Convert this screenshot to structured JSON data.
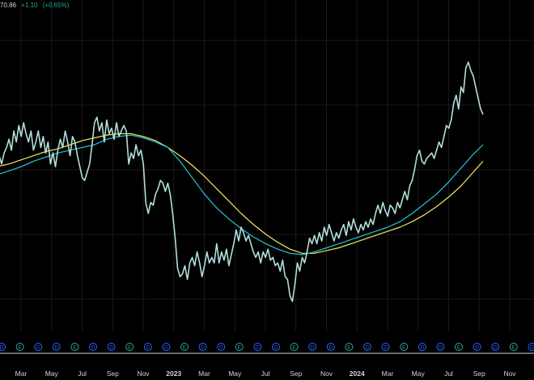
{
  "header": {
    "price": "70.86",
    "change": "+1.10",
    "change_pct": "(+0.65%)"
  },
  "colors": {
    "background": "#000000",
    "grid": "#1a1a1a",
    "price_line": "#b2dfdb",
    "ma_fast": "#26c6da",
    "ma_slow": "#f5e663",
    "dividend": "#2962ff",
    "earnings_green": "#26a69a",
    "earnings_red": "#ef5350",
    "axis_text": "#d1d4dc"
  },
  "chart_data": {
    "type": "line",
    "x_labels": [
      "Mar",
      "May",
      "Jul",
      "Sep",
      "Nov",
      "2023",
      "Mar",
      "May",
      "Jul",
      "Sep",
      "Nov",
      "2024",
      "Mar",
      "May",
      "Jul",
      "Sep",
      "Nov"
    ],
    "x_label_bold": [
      false,
      false,
      false,
      false,
      false,
      true,
      false,
      false,
      false,
      false,
      false,
      true,
      false,
      false,
      false,
      false,
      false
    ],
    "y_visible_range": [
      0,
      100
    ],
    "series": [
      {
        "role": "price",
        "values": [
          [
            0,
            60
          ],
          [
            0.2,
            61
          ],
          [
            0.4,
            58
          ],
          [
            0.6,
            62
          ],
          [
            0.8,
            64
          ],
          [
            1.0,
            67
          ],
          [
            1.2,
            63
          ],
          [
            1.4,
            70
          ],
          [
            1.6,
            66
          ],
          [
            1.8,
            72
          ],
          [
            2.0,
            68
          ],
          [
            2.2,
            73
          ],
          [
            2.4,
            69
          ],
          [
            2.6,
            66
          ],
          [
            2.8,
            70
          ],
          [
            3.0,
            63
          ],
          [
            3.2,
            66
          ],
          [
            3.4,
            70
          ],
          [
            3.6,
            64
          ],
          [
            3.8,
            68
          ],
          [
            4.0,
            62
          ],
          [
            4.2,
            66
          ],
          [
            4.4,
            58
          ],
          [
            4.6,
            62
          ],
          [
            4.8,
            57
          ],
          [
            5.0,
            63
          ],
          [
            5.2,
            67
          ],
          [
            5.4,
            64
          ],
          [
            5.6,
            70
          ],
          [
            5.8,
            66
          ],
          [
            6.0,
            61
          ],
          [
            6.2,
            68
          ],
          [
            6.4,
            66
          ],
          [
            6.6,
            61
          ],
          [
            6.8,
            57
          ],
          [
            7.0,
            53
          ],
          [
            7.2,
            52
          ],
          [
            7.4,
            55
          ],
          [
            7.6,
            58
          ],
          [
            7.8,
            65
          ],
          [
            8.0,
            73
          ],
          [
            8.2,
            75
          ],
          [
            8.4,
            70
          ],
          [
            8.6,
            73
          ],
          [
            8.8,
            66
          ],
          [
            9.0,
            74
          ],
          [
            9.2,
            69
          ],
          [
            9.4,
            71
          ],
          [
            9.6,
            67
          ],
          [
            9.8,
            73
          ],
          [
            10.0,
            68
          ],
          [
            10.2,
            70
          ],
          [
            10.4,
            72
          ],
          [
            10.6,
            70
          ],
          [
            10.8,
            58
          ],
          [
            11.0,
            62
          ],
          [
            11.2,
            60
          ],
          [
            11.4,
            65
          ],
          [
            11.6,
            61
          ],
          [
            11.8,
            63
          ],
          [
            12.0,
            58
          ],
          [
            12.2,
            44
          ],
          [
            12.4,
            40
          ],
          [
            12.6,
            44
          ],
          [
            12.8,
            43
          ],
          [
            13.0,
            47
          ],
          [
            13.2,
            49
          ],
          [
            13.4,
            52
          ],
          [
            13.6,
            51
          ],
          [
            13.8,
            48
          ],
          [
            14.0,
            51
          ],
          [
            14.2,
            47
          ],
          [
            14.4,
            40
          ],
          [
            14.6,
            31
          ],
          [
            14.8,
            20
          ],
          [
            15.0,
            17
          ],
          [
            15.2,
            18
          ],
          [
            15.4,
            21
          ],
          [
            15.6,
            16
          ],
          [
            15.8,
            22
          ],
          [
            16.0,
            24
          ],
          [
            16.2,
            21
          ],
          [
            16.4,
            26
          ],
          [
            16.6,
            22
          ],
          [
            16.8,
            17
          ],
          [
            17.0,
            21
          ],
          [
            17.2,
            26
          ],
          [
            17.4,
            22
          ],
          [
            17.6,
            24
          ],
          [
            17.8,
            22
          ],
          [
            18.0,
            29
          ],
          [
            18.2,
            22
          ],
          [
            18.4,
            26
          ],
          [
            18.6,
            23
          ],
          [
            18.8,
            27
          ],
          [
            19.0,
            21
          ],
          [
            19.2,
            25
          ],
          [
            19.4,
            29
          ],
          [
            19.6,
            34
          ],
          [
            19.8,
            30
          ],
          [
            20.0,
            35
          ],
          [
            20.2,
            33
          ],
          [
            20.4,
            30
          ],
          [
            20.6,
            32
          ],
          [
            20.8,
            29
          ],
          [
            21.0,
            26
          ],
          [
            21.2,
            24
          ],
          [
            21.4,
            26
          ],
          [
            21.6,
            22
          ],
          [
            21.8,
            26
          ],
          [
            22.0,
            24
          ],
          [
            22.2,
            27
          ],
          [
            22.4,
            23
          ],
          [
            22.6,
            24
          ],
          [
            22.8,
            21
          ],
          [
            23.0,
            22
          ],
          [
            23.2,
            19
          ],
          [
            23.4,
            23
          ],
          [
            23.6,
            17
          ],
          [
            23.8,
            16
          ],
          [
            24.0,
            10
          ],
          [
            24.2,
            8
          ],
          [
            24.4,
            14
          ],
          [
            24.6,
            22
          ],
          [
            24.8,
            19
          ],
          [
            25.0,
            24
          ],
          [
            25.2,
            22
          ],
          [
            25.4,
            26
          ],
          [
            25.6,
            31
          ],
          [
            25.8,
            29
          ],
          [
            26.0,
            32
          ],
          [
            26.2,
            29
          ],
          [
            26.4,
            33
          ],
          [
            26.6,
            30
          ],
          [
            26.8,
            35
          ],
          [
            27.0,
            32
          ],
          [
            27.2,
            36
          ],
          [
            27.4,
            33
          ],
          [
            27.6,
            30
          ],
          [
            27.8,
            33
          ],
          [
            28.0,
            31
          ],
          [
            28.2,
            34
          ],
          [
            28.4,
            36
          ],
          [
            28.6,
            32
          ],
          [
            28.8,
            37
          ],
          [
            29.0,
            34
          ],
          [
            29.2,
            38
          ],
          [
            29.4,
            35
          ],
          [
            29.6,
            33
          ],
          [
            29.8,
            36
          ],
          [
            30.0,
            34
          ],
          [
            30.2,
            37
          ],
          [
            30.4,
            35
          ],
          [
            30.6,
            38
          ],
          [
            30.8,
            36
          ],
          [
            31.0,
            40
          ],
          [
            31.2,
            43
          ],
          [
            31.4,
            40
          ],
          [
            31.6,
            44
          ],
          [
            31.8,
            41
          ],
          [
            32.0,
            39
          ],
          [
            32.2,
            43
          ],
          [
            32.4,
            42
          ],
          [
            32.6,
            40
          ],
          [
            32.8,
            44
          ],
          [
            33.0,
            42
          ],
          [
            33.2,
            45
          ],
          [
            33.4,
            48
          ],
          [
            33.6,
            45
          ],
          [
            33.8,
            50
          ],
          [
            34.0,
            52
          ],
          [
            34.2,
            56
          ],
          [
            34.4,
            61
          ],
          [
            34.6,
            63
          ],
          [
            34.8,
            59
          ],
          [
            35.0,
            58
          ],
          [
            35.2,
            60
          ],
          [
            35.4,
            61
          ],
          [
            35.6,
            62
          ],
          [
            35.8,
            60
          ],
          [
            36.0,
            63
          ],
          [
            36.2,
            66
          ],
          [
            36.4,
            64
          ],
          [
            36.6,
            68
          ],
          [
            36.8,
            72
          ],
          [
            37.0,
            71
          ],
          [
            37.2,
            74
          ],
          [
            37.4,
            80
          ],
          [
            37.6,
            83
          ],
          [
            37.8,
            78
          ],
          [
            38.0,
            86
          ],
          [
            38.2,
            84
          ],
          [
            38.4,
            93
          ],
          [
            38.6,
            95
          ],
          [
            38.8,
            92
          ],
          [
            39.0,
            90
          ],
          [
            39.2,
            86
          ],
          [
            39.4,
            82
          ],
          [
            39.6,
            78
          ],
          [
            39.8,
            76
          ]
        ]
      },
      {
        "role": "moving_average_fast",
        "values": [
          [
            0,
            54
          ],
          [
            1.0,
            55.5
          ],
          [
            2.0,
            57
          ],
          [
            3.0,
            59
          ],
          [
            4.0,
            60.5
          ],
          [
            5.0,
            62
          ],
          [
            6.0,
            63
          ],
          [
            7.0,
            64
          ],
          [
            8.0,
            65
          ],
          [
            9.0,
            67
          ],
          [
            10.0,
            68
          ],
          [
            11.0,
            68.5
          ],
          [
            12.0,
            67.5
          ],
          [
            13.0,
            66
          ],
          [
            14.0,
            64
          ],
          [
            15.0,
            59
          ],
          [
            16.0,
            53
          ],
          [
            17.0,
            47
          ],
          [
            18.0,
            42
          ],
          [
            19.0,
            38
          ],
          [
            20.0,
            34.5
          ],
          [
            21.0,
            31.5
          ],
          [
            22.0,
            29
          ],
          [
            23.0,
            27
          ],
          [
            24.0,
            25.5
          ],
          [
            25.0,
            25
          ],
          [
            26.0,
            26
          ],
          [
            27.0,
            27.5
          ],
          [
            28.0,
            29
          ],
          [
            29.0,
            30.5
          ],
          [
            30.0,
            32
          ],
          [
            31.0,
            33.5
          ],
          [
            32.0,
            35
          ],
          [
            33.0,
            37
          ],
          [
            34.0,
            40
          ],
          [
            35.0,
            43.5
          ],
          [
            36.0,
            47
          ],
          [
            37.0,
            51.5
          ],
          [
            38.0,
            56.5
          ],
          [
            39.0,
            61.5
          ],
          [
            39.8,
            65
          ]
        ]
      },
      {
        "role": "moving_average_slow",
        "values": [
          [
            0,
            57
          ],
          [
            1.0,
            58
          ],
          [
            2.0,
            59.5
          ],
          [
            3.0,
            61
          ],
          [
            4.0,
            62.5
          ],
          [
            5.0,
            63.5
          ],
          [
            6.0,
            65
          ],
          [
            7.0,
            66.5
          ],
          [
            8.0,
            67.5
          ],
          [
            9.0,
            68.5
          ],
          [
            10.0,
            69
          ],
          [
            11.0,
            69
          ],
          [
            12.0,
            68
          ],
          [
            13.0,
            66.5
          ],
          [
            14.0,
            64
          ],
          [
            15.0,
            61
          ],
          [
            16.0,
            57.5
          ],
          [
            17.0,
            53.5
          ],
          [
            18.0,
            49
          ],
          [
            19.0,
            44.5
          ],
          [
            20.0,
            40
          ],
          [
            21.0,
            36
          ],
          [
            22.0,
            32.5
          ],
          [
            23.0,
            29.5
          ],
          [
            24.0,
            27
          ],
          [
            25.0,
            25.5
          ],
          [
            26.0,
            25.5
          ],
          [
            27.0,
            26.5
          ],
          [
            28.0,
            27.5
          ],
          [
            29.0,
            29
          ],
          [
            30.0,
            30.5
          ],
          [
            31.0,
            32
          ],
          [
            32.0,
            33.5
          ],
          [
            33.0,
            35
          ],
          [
            34.0,
            37
          ],
          [
            35.0,
            39.5
          ],
          [
            36.0,
            42.5
          ],
          [
            37.0,
            46
          ],
          [
            38.0,
            50
          ],
          [
            39.0,
            55
          ],
          [
            39.8,
            59
          ]
        ]
      }
    ]
  },
  "events": [
    {
      "type": "D"
    },
    {
      "type": "E"
    },
    {
      "type": "D"
    },
    {
      "type": "D"
    },
    {
      "type": "E"
    },
    {
      "type": "D"
    },
    {
      "type": "D"
    },
    {
      "type": "E"
    },
    {
      "type": "D"
    },
    {
      "type": "D"
    },
    {
      "type": "E"
    },
    {
      "type": "D"
    },
    {
      "type": "D"
    },
    {
      "type": "E"
    },
    {
      "type": "D"
    },
    {
      "type": "D"
    },
    {
      "type": "E"
    },
    {
      "type": "D"
    },
    {
      "type": "D"
    },
    {
      "type": "E"
    },
    {
      "type": "D"
    },
    {
      "type": "D"
    },
    {
      "type": "E"
    },
    {
      "type": "D"
    },
    {
      "type": "D"
    },
    {
      "type": "E"
    },
    {
      "type": "D"
    },
    {
      "type": "D"
    },
    {
      "type": "E"
    },
    {
      "type": "D"
    }
  ]
}
